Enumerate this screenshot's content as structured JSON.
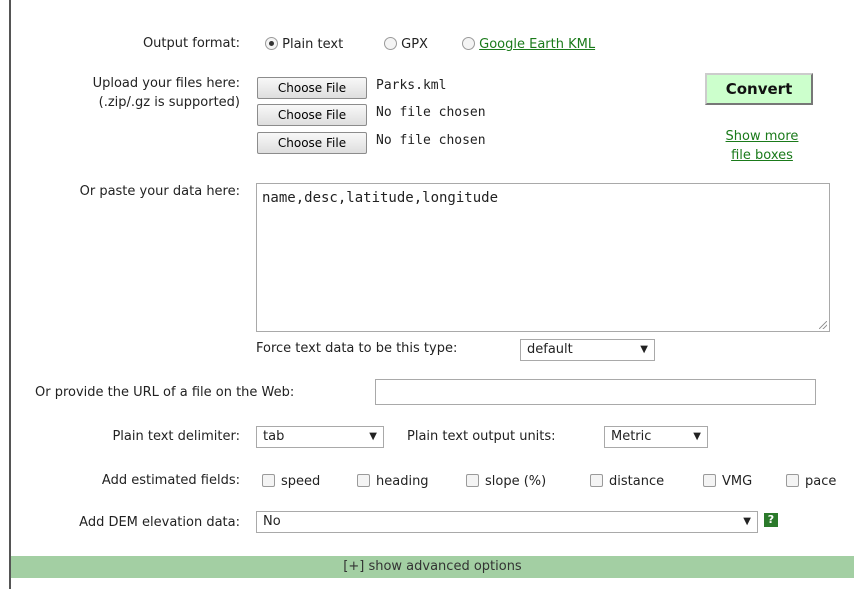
{
  "output_format": {
    "label": "Output format:",
    "options": [
      {
        "label": "Plain text",
        "checked": true
      },
      {
        "label": "GPX",
        "checked": false
      },
      {
        "label": "Google Earth KML",
        "checked": false
      }
    ]
  },
  "upload": {
    "label_line1": "Upload your files here:",
    "label_line2": "(.zip/.gz is supported)",
    "button_label": "Choose File",
    "files": [
      "Parks.kml",
      "No file chosen",
      "No file chosen"
    ],
    "convert_label": "Convert",
    "show_more_line1": "Show more",
    "show_more_line2": "file boxes"
  },
  "paste": {
    "label": "Or paste your data here:",
    "value": "name,desc,latitude,longitude",
    "force_type_label": "Force text data to be this type:",
    "force_type_value": "default"
  },
  "url": {
    "label": "Or provide the URL of a file on the Web:",
    "value": ""
  },
  "delimiter": {
    "label": "Plain text delimiter:",
    "value": "tab",
    "units_label": "Plain text output units:",
    "units_value": "Metric"
  },
  "estimated": {
    "label": "Add estimated fields:",
    "fields": [
      "speed",
      "heading",
      "slope (%)",
      "distance",
      "VMG",
      "pace"
    ]
  },
  "dem": {
    "label": "Add DEM elevation data:",
    "value": "No",
    "help_glyph": "?"
  },
  "advanced": {
    "label": "[+] show advanced options"
  },
  "colors": {
    "convert_bg": "#ccffcc",
    "advanced_bar": "#a3cfa3",
    "link": "#1a7a1a"
  }
}
